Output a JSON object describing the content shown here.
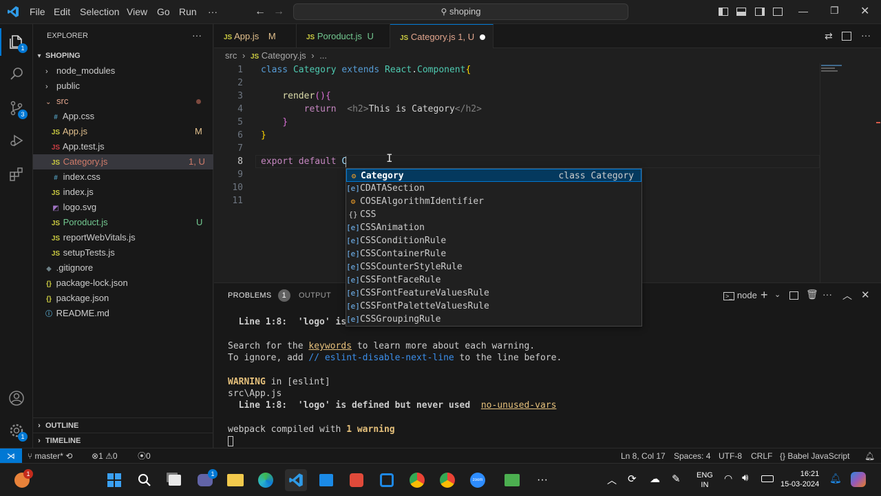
{
  "titlebar": {
    "menu": [
      "File",
      "Edit",
      "Selection",
      "View",
      "Go",
      "Run",
      "···"
    ],
    "search_text": "shoping"
  },
  "activity": {
    "explorer_badge": "1",
    "scm_badge": "3",
    "settings_badge": "1"
  },
  "sidebar": {
    "title": "EXPLORER",
    "project": "SHOPING",
    "items": [
      {
        "label": "node_modules",
        "kind": "folder",
        "status": ""
      },
      {
        "label": "public",
        "kind": "folder",
        "status": ""
      },
      {
        "label": "src",
        "kind": "folder-open",
        "status": ""
      },
      {
        "label": "App.css",
        "kind": "css",
        "status": ""
      },
      {
        "label": "App.js",
        "kind": "js",
        "status": "M"
      },
      {
        "label": "App.test.js",
        "kind": "js",
        "status": ""
      },
      {
        "label": "Category.js",
        "kind": "js",
        "status": "1, U"
      },
      {
        "label": "index.css",
        "kind": "css",
        "status": ""
      },
      {
        "label": "index.js",
        "kind": "js",
        "status": ""
      },
      {
        "label": "logo.svg",
        "kind": "svg",
        "status": ""
      },
      {
        "label": "Poroduct.js",
        "kind": "js",
        "status": "U"
      },
      {
        "label": "reportWebVitals.js",
        "kind": "js",
        "status": ""
      },
      {
        "label": "setupTests.js",
        "kind": "js",
        "status": ""
      },
      {
        "label": ".gitignore",
        "kind": "git",
        "status": ""
      },
      {
        "label": "package-lock.json",
        "kind": "json",
        "status": ""
      },
      {
        "label": "package.json",
        "kind": "json",
        "status": ""
      },
      {
        "label": "README.md",
        "kind": "info",
        "status": ""
      }
    ],
    "outline": "OUTLINE",
    "timeline": "TIMELINE"
  },
  "tabs": [
    {
      "label": "App.js",
      "status": "M"
    },
    {
      "label": "Poroduct.js",
      "status": "U"
    },
    {
      "label": "Category.js",
      "status": "1, U"
    }
  ],
  "breadcrumbs": {
    "folder": "src",
    "file": "Category.js",
    "rest": "..."
  },
  "editor": {
    "line_numbers": [
      "1",
      "2",
      "3",
      "4",
      "5",
      "6",
      "7",
      "8",
      "9",
      "10",
      "11"
    ],
    "lines": [
      "class Category extends React.Component{",
      "",
      "    render(){",
      "        return  <h2>This is Category</h2>",
      "    }",
      "}",
      "",
      "export default C",
      "",
      "",
      ""
    ]
  },
  "suggest": {
    "detail": "class Category",
    "items": [
      {
        "label": "Category",
        "icon": "class-icon"
      },
      {
        "label": "CDATASection",
        "icon": "variable-icon"
      },
      {
        "label": "COSEAlgorithmIdentifier",
        "icon": "class-icon"
      },
      {
        "label": "CSS",
        "icon": "module-icon"
      },
      {
        "label": "CSSAnimation",
        "icon": "variable-icon"
      },
      {
        "label": "CSSConditionRule",
        "icon": "variable-icon"
      },
      {
        "label": "CSSContainerRule",
        "icon": "variable-icon"
      },
      {
        "label": "CSSCounterStyleRule",
        "icon": "variable-icon"
      },
      {
        "label": "CSSFontFaceRule",
        "icon": "variable-icon"
      },
      {
        "label": "CSSFontFeatureValuesRule",
        "icon": "variable-icon"
      },
      {
        "label": "CSSFontPaletteValuesRule",
        "icon": "variable-icon"
      },
      {
        "label": "CSSGroupingRule",
        "icon": "variable-icon"
      }
    ]
  },
  "panel": {
    "tabs": [
      "PROBLEMS",
      "OUTPUT"
    ],
    "problems_count": "1",
    "terminal_name": "node",
    "terminal": {
      "l1a": "  Line 1:8:  'logo' is ",
      "l2a": "Search for the ",
      "l2b": "keywords",
      "l2c": " to learn more about each warning.",
      "l3a": "To ignore, add ",
      "l3b": "// eslint-disable-next-line",
      "l3c": " to the line before.",
      "l4a": "WARNING",
      "l4b": " in [eslint]",
      "l5": "src\\App.js",
      "l6a": "  Line 1:8:  'logo' is defined but never used  ",
      "l6b": "no-unused-vars",
      "l7a": "webpack compiled with ",
      "l7b": "1 warning"
    }
  },
  "status": {
    "branch": "master*",
    "errors": "1",
    "warnings": "0",
    "ports": "0",
    "position": "Ln 8, Col 17",
    "spaces": "Spaces: 4",
    "encoding": "UTF-8",
    "eol": "CRLF",
    "language": "Babel JavaScript"
  },
  "taskbar": {
    "weather_badge": "1",
    "chat_badge": "1",
    "lang1": "ENG",
    "lang2": "IN",
    "time": "16:21",
    "date": "15-03-2024"
  },
  "colors": {
    "accent": "#0078d4",
    "keyword": "#569cd6",
    "class": "#4ec9b0",
    "func": "#dcdcaa",
    "js": "#cbcb41",
    "untracked": "#73c991",
    "modified": "#e2c08d",
    "warn": "#cca700"
  }
}
